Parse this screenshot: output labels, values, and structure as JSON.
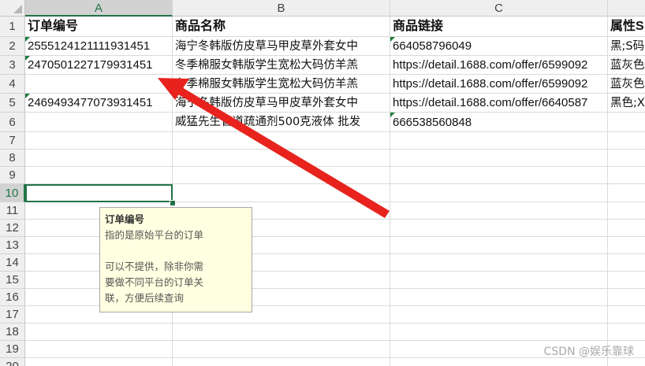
{
  "columns": [
    "A",
    "B",
    "C"
  ],
  "column_d_partial": "",
  "rows": [
    "1",
    "2",
    "3",
    "4",
    "5",
    "6",
    "7",
    "8",
    "9",
    "10",
    "11",
    "12",
    "13",
    "14",
    "15",
    "16",
    "17",
    "18",
    "19",
    "20"
  ],
  "selected_column": "A",
  "selected_row": "10",
  "header": {
    "a": "订单编号",
    "b": "商品名称",
    "c": "商品链接",
    "d": "属性S"
  },
  "data": [
    {
      "a": "2555124121111931451",
      "b": "海宁冬韩版仿皮草马甲皮草外套女中",
      "c": "664058796049",
      "d": "黑;S码"
    },
    {
      "a": "2470501227179931451",
      "b": "冬季棉服女韩版学生宽松大码仿羊羔",
      "c": "https://detail.1688.com/offer/6599092",
      "d": "蓝灰色"
    },
    {
      "a": "",
      "b": "冬季棉服女韩版学生宽松大码仿羊羔",
      "c": "https://detail.1688.com/offer/6599092",
      "d": "蓝灰色"
    },
    {
      "a": "2469493477073931451",
      "b": "海宁冬韩版仿皮草马甲皮草外套女中",
      "c": "https://detail.1688.com/offer/6640587",
      "d": "黑色;X"
    },
    {
      "a": "",
      "b": "威猛先生管道疏通剂500克液体 批发",
      "c": "666538560848",
      "d": ""
    }
  ],
  "comment": {
    "title": "订单编号",
    "line1": "指的是原始平台的订单",
    "line2": "可以不提供，除非你需",
    "line3": "要做不同平台的订单关",
    "line4": "联，方便后续查询"
  },
  "watermark": "CSDN @娱乐靠球",
  "colors": {
    "accent": "#217346",
    "arrow": "#e8231e",
    "comment_bg": "#ffffe1"
  }
}
